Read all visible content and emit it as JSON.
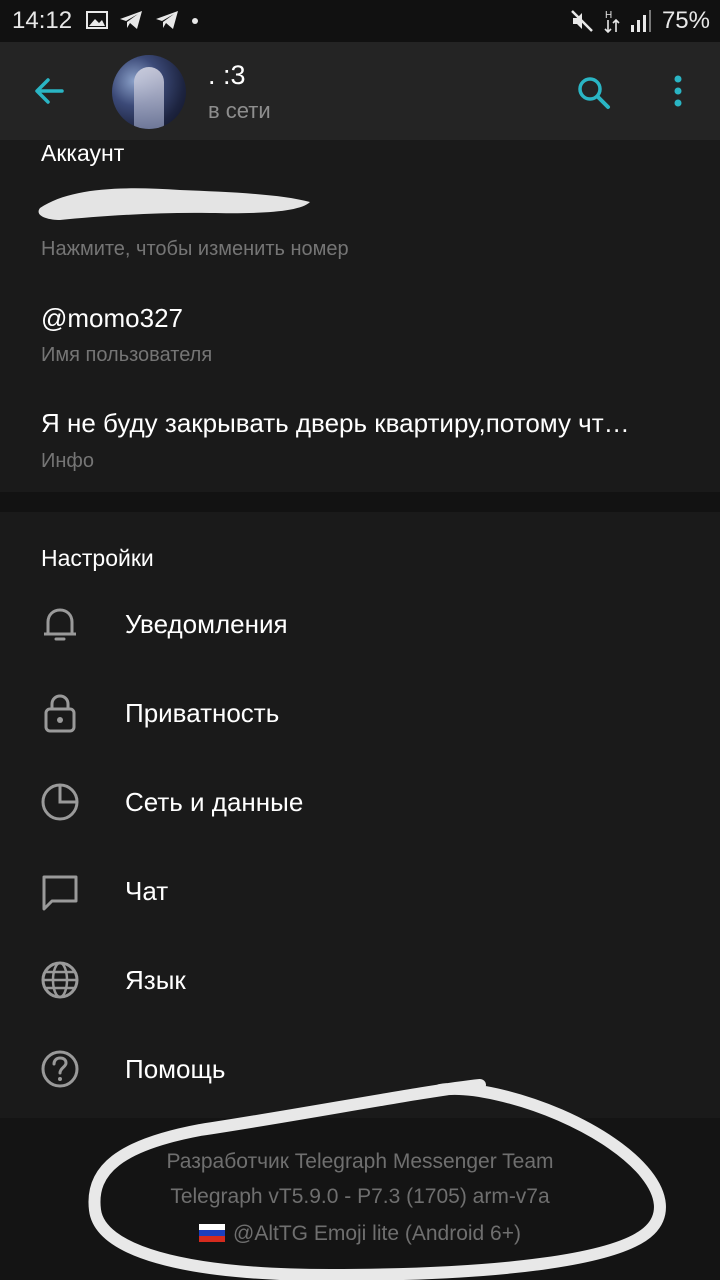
{
  "status_bar": {
    "time": "14:12",
    "left_icons": [
      "gallery-icon",
      "telegram-icon",
      "telegram-icon",
      "dot"
    ],
    "battery": "75%"
  },
  "app_bar": {
    "chat_name": ". :3",
    "status": "в сети"
  },
  "account": {
    "header": "Аккаунт",
    "phone_hint": "Нажмите, чтобы изменить номер",
    "username": "@momo327",
    "username_label": "Имя пользователя",
    "bio": "Я не буду закрывать дверь квартиру,потому чт…",
    "bio_label": "Инфо"
  },
  "settings": {
    "header": "Настройки",
    "items": [
      {
        "label": "Уведомления",
        "icon": "bell-icon"
      },
      {
        "label": "Приватность",
        "icon": "lock-icon"
      },
      {
        "label": "Сеть и данные",
        "icon": "clock-pie-icon"
      },
      {
        "label": "Чат",
        "icon": "chat-bubble-icon"
      },
      {
        "label": "Язык",
        "icon": "globe-icon"
      },
      {
        "label": "Помощь",
        "icon": "help-circle-icon"
      }
    ]
  },
  "footer": {
    "developer": "Разработчик Telegraph Messenger Team",
    "version": "Telegraph vT5.9.0 - P7.3 (1705) arm-v7a",
    "emoji": "@AltTG Emoji lite (Android 6+)"
  },
  "colors": {
    "accent": "#2ab5c4",
    "background": "#1a1a1a",
    "app_bar": "#242424",
    "secondary_text": "#757575"
  }
}
